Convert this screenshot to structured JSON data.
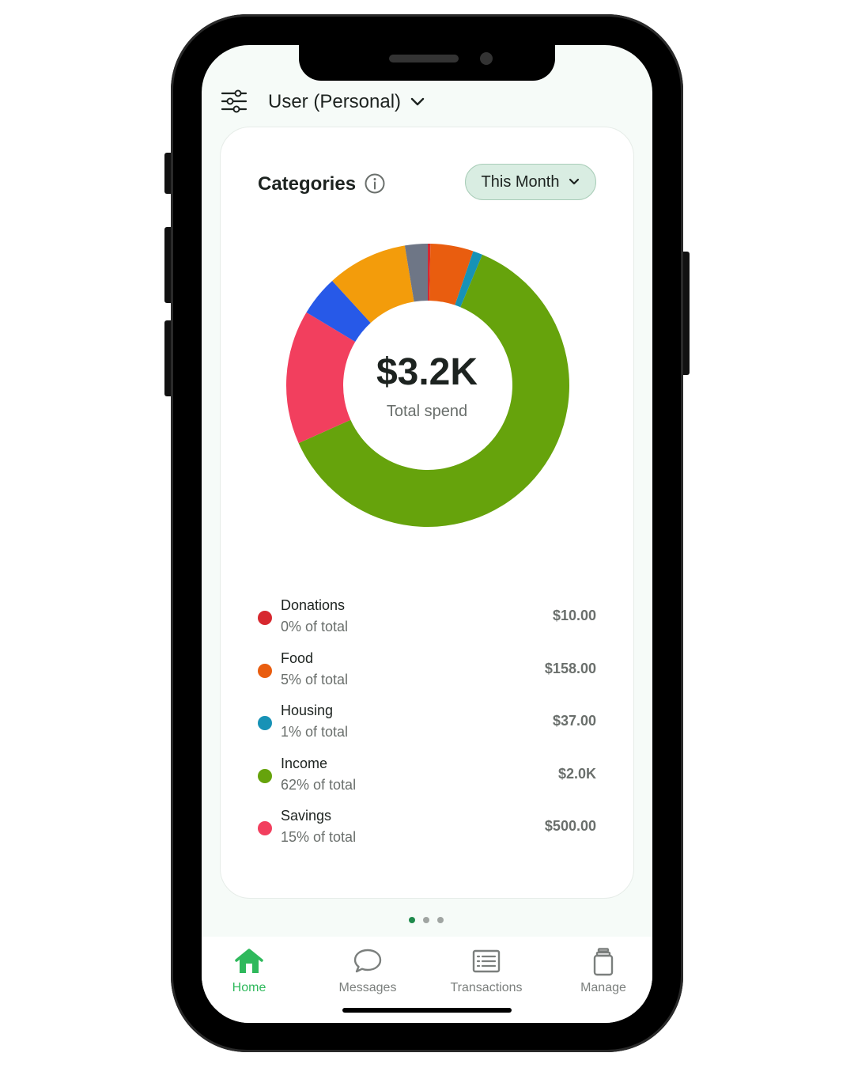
{
  "header": {
    "account_label": "User (Personal)"
  },
  "card": {
    "title": "Categories",
    "period_label": "This Month",
    "total_value": "$3.2K",
    "total_caption": "Total spend"
  },
  "chart_data": {
    "type": "pie",
    "segments": [
      {
        "label": "Donations",
        "share": 0.003,
        "color": "#d7282f"
      },
      {
        "label": "Food",
        "share": 0.049,
        "color": "#e95d0f"
      },
      {
        "label": "Housing",
        "share": 0.011,
        "color": "#1792b6"
      },
      {
        "label": "Income",
        "share": 0.62,
        "color": "#66a30c"
      },
      {
        "label": "Savings",
        "share": 0.153,
        "color": "#f23f5e"
      },
      {
        "label": "",
        "share": 0.046,
        "color": "#2759e8"
      },
      {
        "label": "",
        "share": 0.092,
        "color": "#f39c0b"
      },
      {
        "label": "",
        "share": 0.026,
        "color": "#6e7686"
      }
    ]
  },
  "legend": [
    {
      "name": "Donations",
      "pct": "0% of total",
      "amount": "$10.00",
      "color": "#d7282f"
    },
    {
      "name": "Food",
      "pct": "5% of total",
      "amount": "$158.00",
      "color": "#e95d0f"
    },
    {
      "name": "Housing",
      "pct": "1% of total",
      "amount": "$37.00",
      "color": "#1792b6"
    },
    {
      "name": "Income",
      "pct": "62% of total",
      "amount": "$2.0K",
      "color": "#66a30c"
    },
    {
      "name": "Savings",
      "pct": "15% of total",
      "amount": "$500.00",
      "color": "#f23f5e"
    }
  ],
  "pager": {
    "count": 3,
    "active": 0
  },
  "nav": {
    "items": [
      {
        "label": "Home",
        "icon": "home-icon"
      },
      {
        "label": "Messages",
        "icon": "chat-bubble-icon"
      },
      {
        "label": "Transactions",
        "icon": "list-icon"
      },
      {
        "label": "Manage",
        "icon": "jar-icon"
      }
    ],
    "active_color": "#2fb95c"
  }
}
